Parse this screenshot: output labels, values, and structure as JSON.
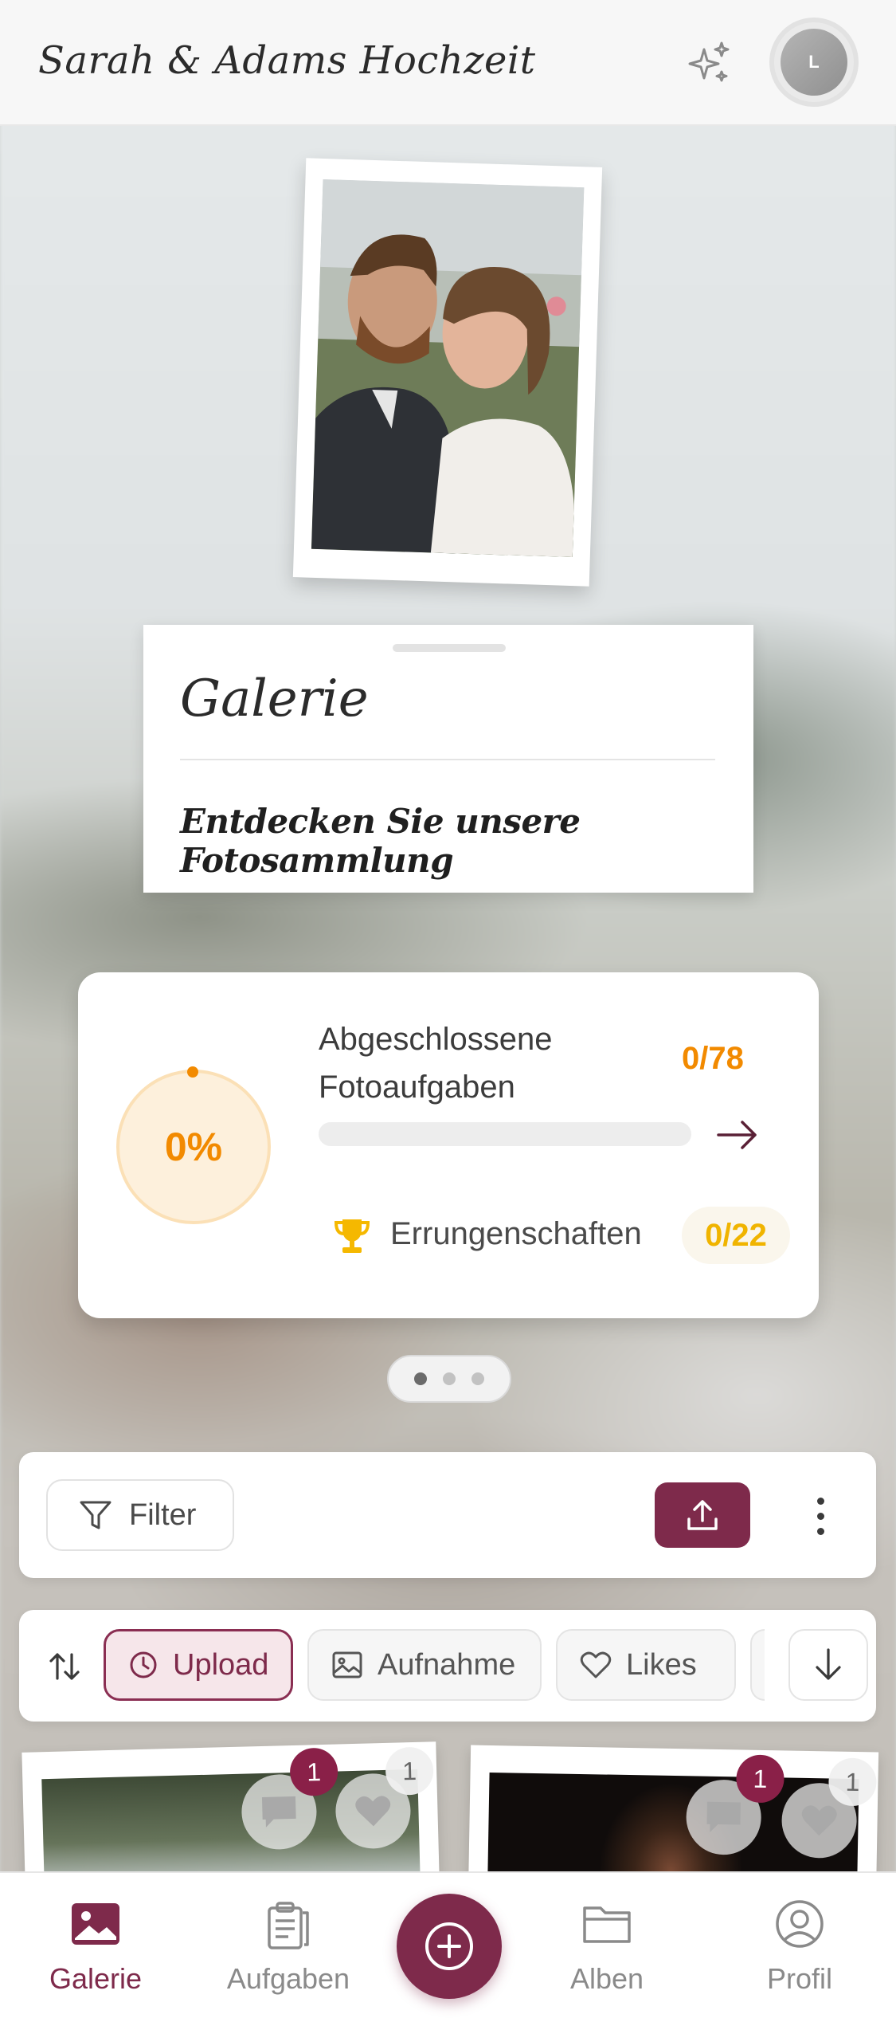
{
  "header": {
    "title": "Sarah & Adams Hochzeit",
    "avatar_initial": "L"
  },
  "gallery_card": {
    "title": "Galerie",
    "subtitle": "Entdecken Sie unsere Fotosammlung"
  },
  "progress": {
    "percent_label": "0%",
    "percent": 0,
    "label": "Abgeschlossene Fotoaufgaben",
    "count": "0/78",
    "achievements_label": "Errungenschaften",
    "achievements_count": "0/22"
  },
  "pager": {
    "pages": 3,
    "active": 0
  },
  "toolbar": {
    "filter_label": "Filter"
  },
  "sort": {
    "chips": [
      {
        "label": "Upload",
        "active": true
      },
      {
        "label": "Aufnahme",
        "active": false
      },
      {
        "label": "Likes",
        "active": false
      }
    ]
  },
  "tiles": [
    {
      "comments": "1",
      "likes": "1"
    },
    {
      "comments": "1",
      "likes": "1"
    }
  ],
  "nav": {
    "items": [
      {
        "label": "Galerie"
      },
      {
        "label": "Aufgaben"
      },
      {
        "label": "Alben"
      },
      {
        "label": "Profil"
      }
    ]
  },
  "colors": {
    "brand": "#7e2a4b",
    "accent_orange": "#f28a00",
    "accent_gold": "#f0b400"
  }
}
